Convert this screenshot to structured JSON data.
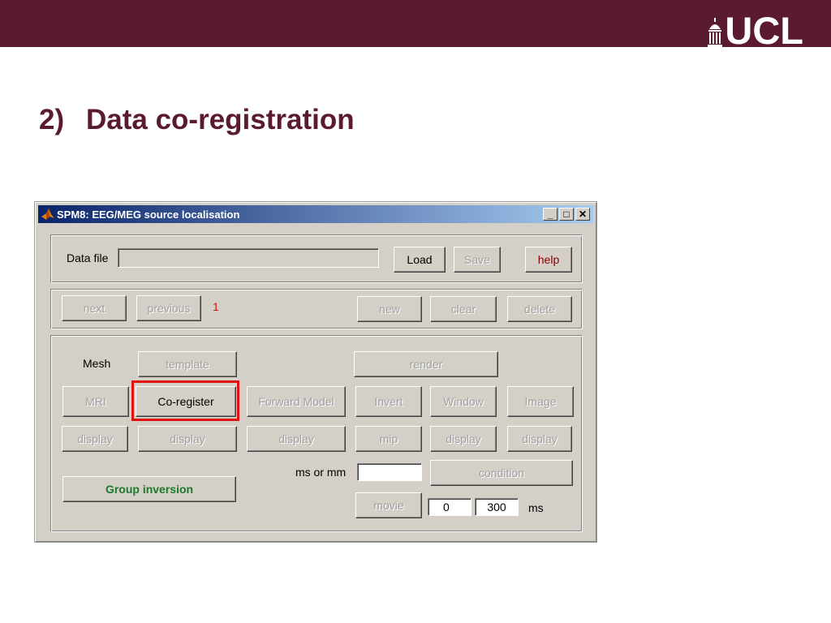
{
  "slide": {
    "logo_text": "UCL",
    "title_number": "2)",
    "title_text": "Data co-registration"
  },
  "window": {
    "title": "SPM8: EEG/MEG source localisation",
    "controls": {
      "minimize": "_",
      "maximize": "□",
      "close": "✕"
    }
  },
  "file_panel": {
    "data_file_label": "Data file",
    "data_file_value": "",
    "load": "Load",
    "save": "Save",
    "help": "help"
  },
  "nav_panel": {
    "next": "next",
    "previous": "previous",
    "index": "1",
    "new": "new",
    "clear": "clear",
    "delete": "delete"
  },
  "main_panel": {
    "mesh_label": "Mesh",
    "template": "template",
    "render": "render",
    "mri": "MRI",
    "coregister": "Co-register",
    "forward_model": "Forward Model",
    "invert": "Invert",
    "window": "Window",
    "image": "Image",
    "display_mri": "display",
    "display_coreg": "display",
    "display_forward": "display",
    "mip": "mip",
    "display_window": "display",
    "display_image": "display",
    "ms_or_mm_label": "ms or mm",
    "ms_or_mm_value": "",
    "condition": "condition",
    "group_inversion": "Group inversion",
    "movie": "movie",
    "time_start": "0",
    "time_end": "300",
    "ms_unit": "ms"
  },
  "colors": {
    "brand": "#5a1a30",
    "highlight": "#e01010",
    "group_inversion_text": "#1a7a2a",
    "help_text": "#8b0000"
  }
}
